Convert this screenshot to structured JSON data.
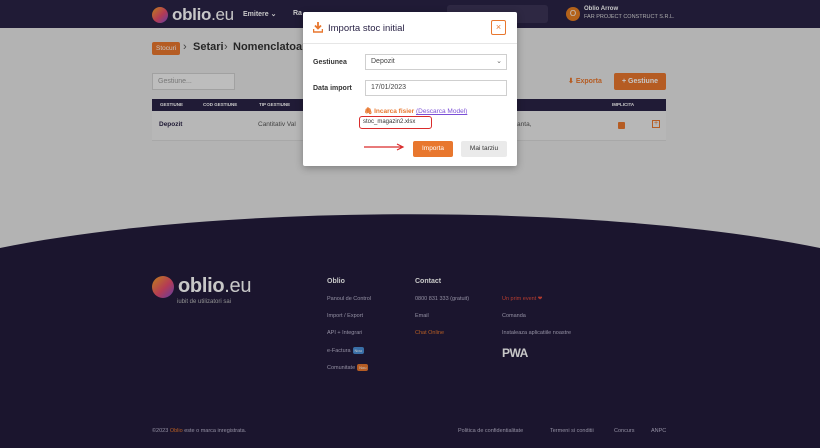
{
  "brand": {
    "name": "oblio",
    "tld": ".eu"
  },
  "nav": {
    "items": [
      "Emitere ⌄",
      "Ra"
    ]
  },
  "user": {
    "initial": "O",
    "name": "Oblio Arrow",
    "company": "FAR PROJECT CONSTRUCT S.R.L."
  },
  "breadcrumb": {
    "badge": "Stocuri",
    "sep": "›",
    "items": [
      "Setari",
      "Nomenclatoare"
    ]
  },
  "filter": {
    "placeholder": "Gestiune..."
  },
  "actions": {
    "export": "Exporta",
    "add": "+ Gestiune"
  },
  "table": {
    "columns": [
      "GESTIUNE",
      "COD GESTIUNE",
      "TIP GESTIUNE",
      "IMPLICITA"
    ],
    "rows": [
      {
        "name": "Depozit",
        "type": "Cantitativ Val",
        "extra": "stanta,"
      }
    ]
  },
  "footer": {
    "tagline": "iubit de utilizatori sai",
    "col1": {
      "title": "Oblio",
      "links": [
        "Panoul de Control",
        "Import / Export",
        "API + Integrari",
        "e-Factura",
        "Comunitate"
      ],
      "badges": [
        "Nou",
        "Nou"
      ]
    },
    "col2": {
      "title": "Contact",
      "phone": "0800 831 333 (gratuit)",
      "email": "Email",
      "chat": "Chat Online"
    },
    "col3": {
      "love": "Un prim event ❤",
      "order": "Comanda",
      "install": "Instaleaza aplicatiile noastre",
      "pwa": "PWA"
    },
    "bottom": {
      "copy_prefix": "©2023",
      "copy_brand": "Oblio",
      "copy_suffix": "este o marca inregistrata.",
      "links": [
        "Politica de confidentialitate",
        "Termeni si conditii",
        "Concurs",
        "ANPC"
      ]
    }
  },
  "modal": {
    "title": "Importa stoc initial",
    "close": "×",
    "gestiune_label": "Gestiunea",
    "gestiune_value": "Depozit",
    "date_label": "Data import",
    "date_value": "17/01/2023",
    "upload_label": "Incarca fisier",
    "model_link": "(Descarca Model)",
    "file_name": "stoc_magazin2.xlsx",
    "import_btn": "Importa",
    "later_btn": "Mai tarziu"
  },
  "colors": {
    "accent": "#e8772e",
    "navy": "#2a2346",
    "highlight": "#d92b2b"
  }
}
